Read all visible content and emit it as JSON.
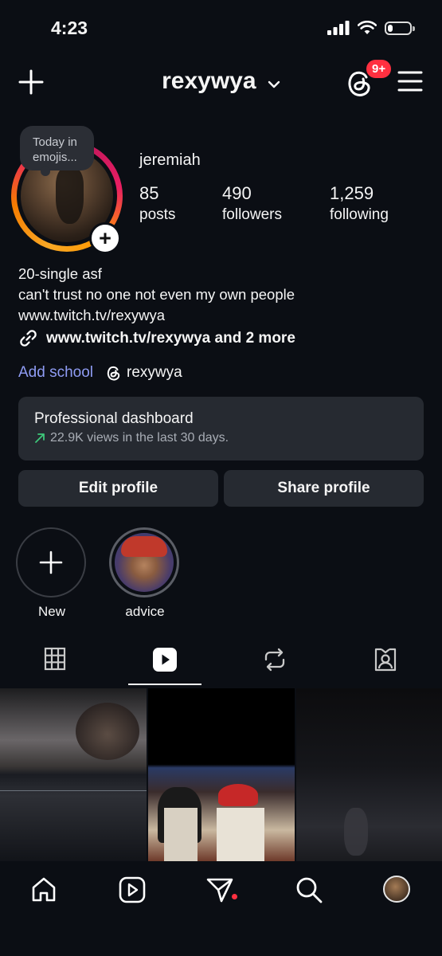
{
  "status_bar": {
    "time": "4:23",
    "battery_level": 0.22
  },
  "header": {
    "username": "rexywya",
    "notifications_badge": "9+"
  },
  "note": {
    "text": "Today in emojis..."
  },
  "profile": {
    "display_name": "jeremiah",
    "stats": [
      {
        "value": "85",
        "label": "posts"
      },
      {
        "value": "490",
        "label": "followers"
      },
      {
        "value": "1,259",
        "label": "following"
      }
    ],
    "bio_lines": [
      "20-single asf",
      "can't trust no one not even my own people",
      "www.twitch.tv/rexywya"
    ],
    "links_text": "www.twitch.tv/rexywya and 2 more",
    "add_school": "Add school",
    "threads_handle": "rexywya"
  },
  "dashboard": {
    "title": "Professional dashboard",
    "subtitle": "22.9K views in the last 30 days.",
    "trend_color": "#3ec77a"
  },
  "buttons": {
    "edit": "Edit profile",
    "share": "Share profile"
  },
  "highlights": [
    {
      "label": "New"
    },
    {
      "label": "advice"
    }
  ],
  "tabs": [
    "grid-icon",
    "reels-icon",
    "reposts-icon",
    "tagged-icon"
  ],
  "active_tab": "reels",
  "accent_colors": {
    "badge": "#ff3040",
    "link": "#8f9cf4"
  }
}
